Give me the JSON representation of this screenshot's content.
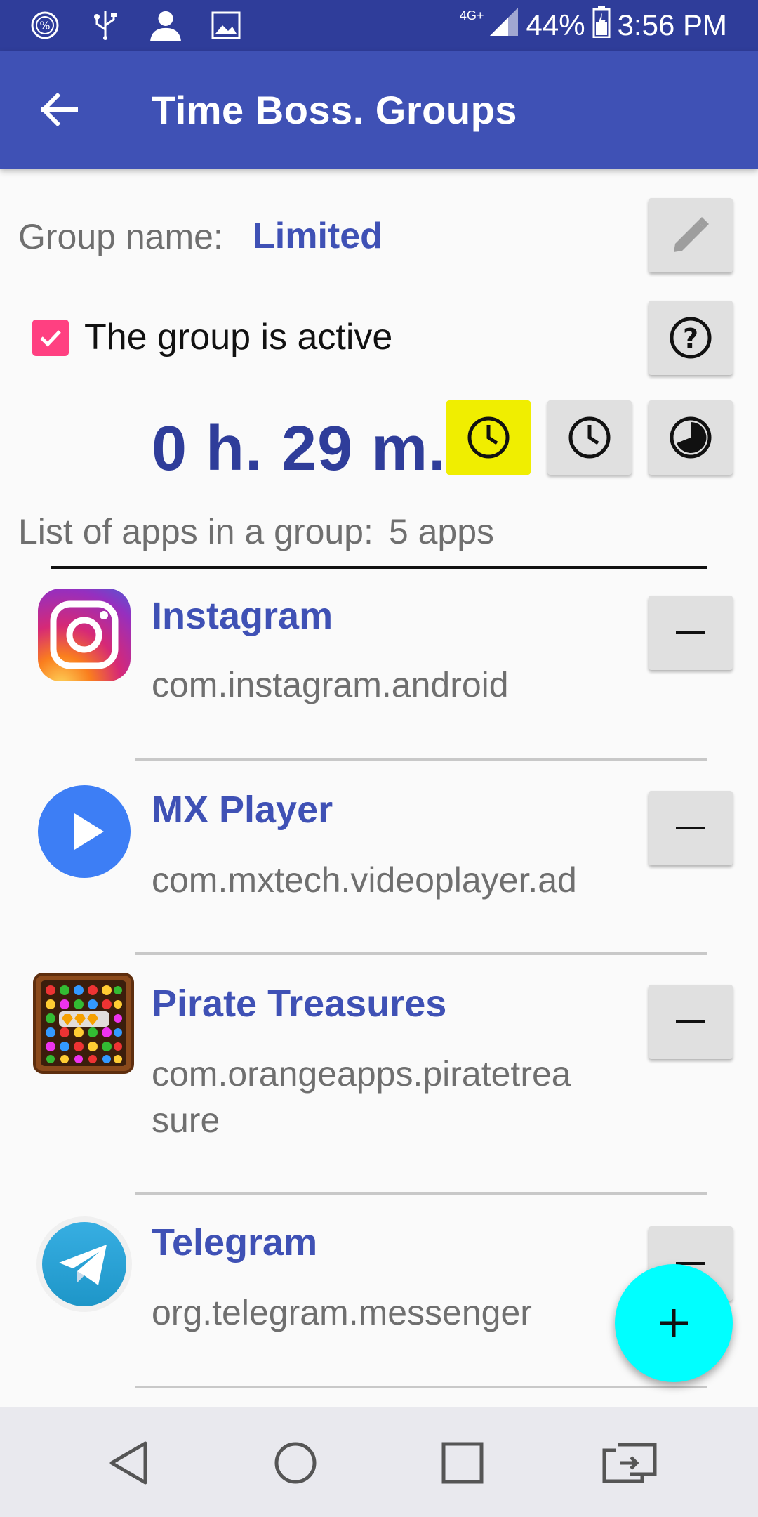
{
  "status_bar": {
    "icons_left": [
      "percent-circle-icon",
      "usb-icon",
      "person-icon",
      "image-icon"
    ],
    "network": "4G+",
    "battery": "44%",
    "time": "3:56 PM"
  },
  "app_bar": {
    "title": "Time Boss. Groups",
    "back_icon": "arrow-left-icon"
  },
  "group": {
    "name_label": "Group name:",
    "name_value": "Limited",
    "active_label": "The group is active",
    "active_checked": true,
    "time_value": "0 h. 29 m."
  },
  "list": {
    "header_label": "List of apps in a group:",
    "count": "5 apps",
    "apps": [
      {
        "name": "Instagram",
        "package": "com.instagram.android",
        "icon": "instagram-icon"
      },
      {
        "name": "MX Player",
        "package": "com.mxtech.videoplayer.ad",
        "icon": "mx-player-icon"
      },
      {
        "name": "Pirate Treasures",
        "package": "com.orangeapps.piratetrea sure",
        "icon": "pirate-treasures-icon"
      },
      {
        "name": "Telegram",
        "package": "org.telegram.messenger",
        "icon": "telegram-icon"
      }
    ]
  },
  "colors": {
    "primary": "#3f51b5",
    "primary_dark": "#2f3d9a",
    "accent": "#ff4081",
    "fab": "#00ffff",
    "timer_highlight": "#f0ee00"
  }
}
